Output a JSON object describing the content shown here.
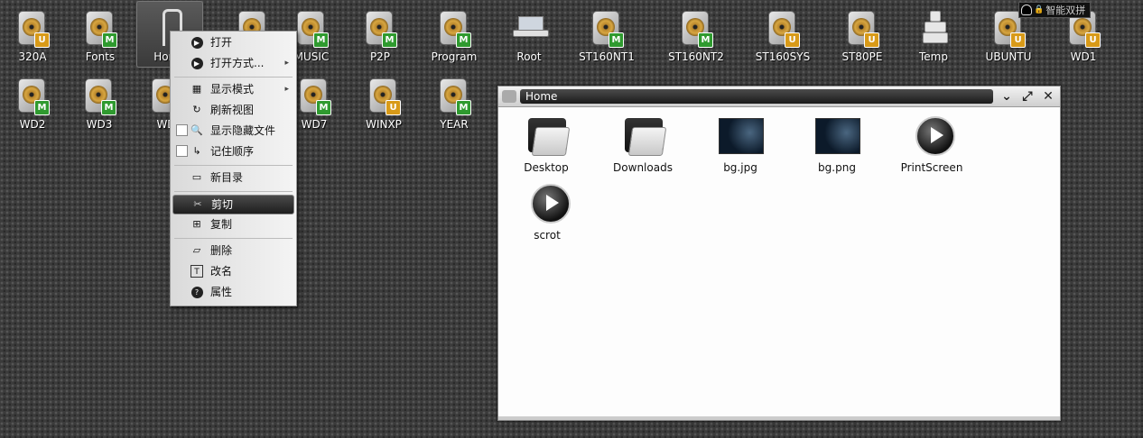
{
  "desktop": {
    "icons": [
      {
        "label": "320A",
        "badge": "U"
      },
      {
        "label": "Fonts",
        "badge": "M"
      },
      {
        "label": "Home",
        "badge": ""
      },
      {
        "label": "",
        "badge": ""
      },
      {
        "label": "MUSIC",
        "badge": "M"
      },
      {
        "label": "P2P",
        "badge": "M"
      },
      {
        "label": "Program",
        "badge": "M"
      },
      {
        "label": "Root",
        "badge": ""
      },
      {
        "label": "ST160NT1",
        "badge": "M"
      },
      {
        "label": "ST160NT2",
        "badge": "M"
      },
      {
        "label": "ST160SYS",
        "badge": "U"
      },
      {
        "label": "ST80PE",
        "badge": "U"
      },
      {
        "label": "Temp",
        "badge": ""
      },
      {
        "label": "UBUNTU",
        "badge": "U"
      },
      {
        "label": "WD1",
        "badge": "U"
      },
      {
        "label": "WD2",
        "badge": "M"
      },
      {
        "label": "WD3",
        "badge": "M"
      },
      {
        "label": "WD",
        "badge": ""
      },
      {
        "label": "WD7",
        "badge": "M"
      },
      {
        "label": "WINXP",
        "badge": "U"
      },
      {
        "label": "YEAR",
        "badge": "M"
      }
    ]
  },
  "tray": {
    "input_method": "智能双拼",
    "lock_glyph": "🔒"
  },
  "context_menu": {
    "items": [
      {
        "label": "打开",
        "icon": "play-icon"
      },
      {
        "label": "打开方式...",
        "icon": "play-icon",
        "submenu": true
      },
      {
        "label": "显示模式",
        "icon": "view-mode-icon",
        "submenu": true
      },
      {
        "label": "刷新视图",
        "icon": "refresh-icon"
      },
      {
        "label": "显示隐藏文件",
        "icon": "search-icon",
        "checkbox": true
      },
      {
        "label": "记住顺序",
        "icon": "sort-icon",
        "checkbox": true
      },
      {
        "label": "新目录",
        "icon": "new-folder-icon"
      },
      {
        "label": "剪切",
        "icon": "cut-icon",
        "active": true
      },
      {
        "label": "复制",
        "icon": "copy-icon"
      },
      {
        "label": "删除",
        "icon": "delete-icon"
      },
      {
        "label": "改名",
        "icon": "rename-icon"
      },
      {
        "label": "属性",
        "icon": "properties-icon"
      }
    ],
    "submenu_arrow": "▸"
  },
  "window": {
    "title": "Home",
    "buttons": {
      "shade": "⌄",
      "maximize": "⤢",
      "close": "✕"
    },
    "files": [
      {
        "name": "Desktop",
        "type": "folder"
      },
      {
        "name": "Downloads",
        "type": "folder"
      },
      {
        "name": "bg.jpg",
        "type": "image"
      },
      {
        "name": "bg.png",
        "type": "image"
      },
      {
        "name": "PrintScreen",
        "type": "executable"
      },
      {
        "name": "scrot",
        "type": "executable"
      }
    ]
  },
  "colors": {
    "badge_m": "#2f9a2f",
    "badge_u": "#d89a18",
    "menu_active": "#1e1e1e"
  }
}
